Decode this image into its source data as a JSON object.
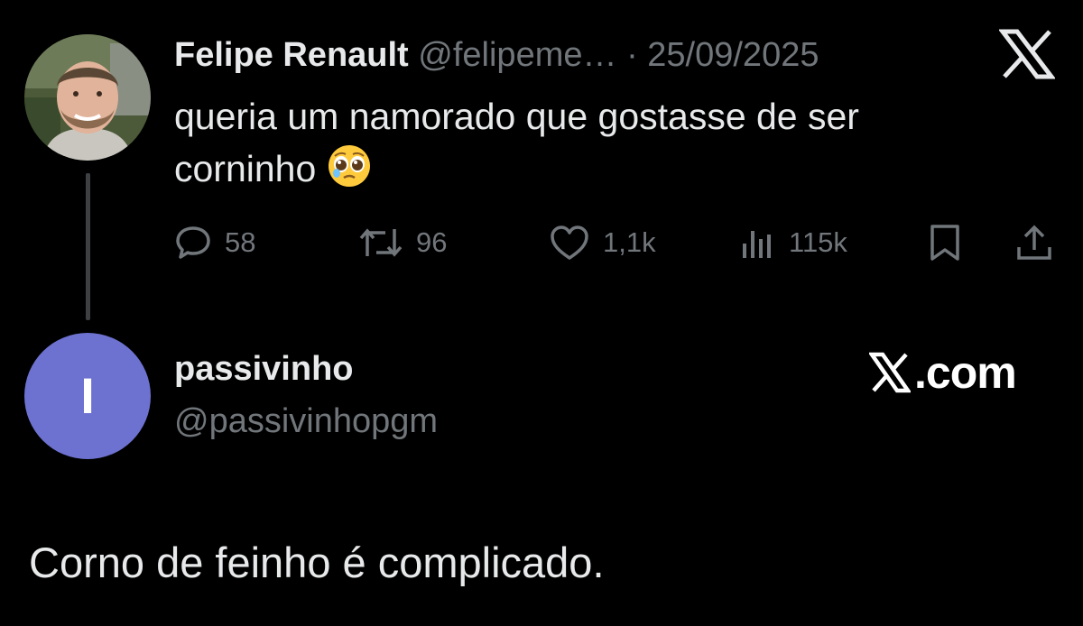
{
  "tweet": {
    "author_name": "Felipe Renault",
    "author_handle": "@felipeme…",
    "separator": "·",
    "date": "25/09/2025",
    "text_line1": "queria um namorado que gostasse de ser",
    "text_line2": "corninho",
    "emoji": "pleading-face-emoji",
    "stats": {
      "replies": "58",
      "reposts": "96",
      "likes": "1,1k",
      "views": "115k"
    },
    "icons": [
      "x-logo-icon",
      "reply-icon",
      "repost-icon",
      "like-icon",
      "views-icon",
      "bookmark-icon",
      "share-icon"
    ]
  },
  "reply": {
    "avatar_letter": "I",
    "avatar_color": "#6d72d1",
    "display_name": "passivinho",
    "handle": "@passivinhopgm",
    "text": "Corno de feinho é complicado."
  },
  "brand": {
    "suffix": ".com"
  },
  "colors": {
    "background": "#000000",
    "primary_text": "#e7e9ea",
    "secondary_text": "#71767b"
  }
}
